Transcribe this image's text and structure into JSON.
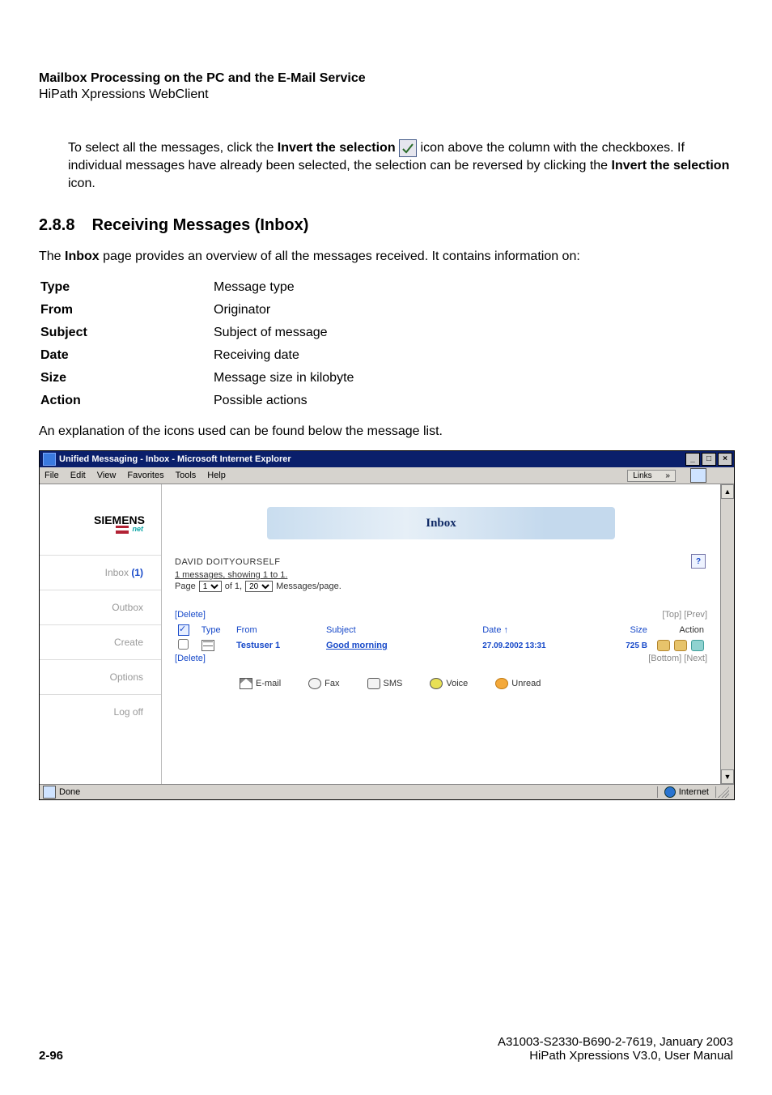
{
  "header": {
    "title": "Mailbox Processing on the PC and the E-Mail Service",
    "subtitle": "HiPath Xpressions WebClient"
  },
  "intro": {
    "pre": "To select all the messages, click the ",
    "bold1": "Invert the selection",
    "mid": " icon above the column with the checkboxes. If individual messages have already been selected, the selection can be reversed by clicking the ",
    "bold2": "Invert the selection",
    "post": " icon."
  },
  "section": {
    "number": "2.8.8",
    "title": "Receiving Messages (Inbox)"
  },
  "lead": {
    "pre": "The ",
    "bold": "Inbox",
    "post": " page provides an overview of all the messages received. It contains information on:"
  },
  "defs": [
    {
      "term": "Type",
      "desc": "Message type"
    },
    {
      "term": "From",
      "desc": "Originator"
    },
    {
      "term": "Subject",
      "desc": "Subject of message"
    },
    {
      "term": "Date",
      "desc": "Receiving date"
    },
    {
      "term": "Size",
      "desc": "Message size in kilobyte"
    },
    {
      "term": "Action",
      "desc": "Possible actions"
    }
  ],
  "explain": "An explanation of the icons used can be found below the message list.",
  "shot": {
    "title": "Unified Messaging - Inbox - Microsoft Internet Explorer",
    "menus": {
      "file": "File",
      "edit": "Edit",
      "view": "View",
      "favorites": "Favorites",
      "tools": "Tools",
      "help": "Help"
    },
    "links_label": "Links",
    "logo": {
      "brand": "SIEMENS",
      "suffix": "net"
    },
    "nav": {
      "inbox_label": "Inbox",
      "inbox_count": "(1)",
      "outbox": "Outbox",
      "create": "Create",
      "options": "Options",
      "logoff": "Log off"
    },
    "banner": "Inbox",
    "user": "DAVID DOITYOURSELF",
    "summary_line": "1 messages, showing 1 to 1.",
    "page_row": {
      "page": "Page",
      "val1": "1",
      "of": "of 1,",
      "val2": "20",
      "per": "Messages/page."
    },
    "actions": {
      "delete": "Delete",
      "top": "Top",
      "prev": "Prev",
      "bottom": "Bottom",
      "next": "Next"
    },
    "cols": {
      "type": "Type",
      "from": "From",
      "subject": "Subject",
      "date": "Date",
      "size": "Size",
      "action": "Action"
    },
    "row": {
      "from": "Testuser 1",
      "subject": "Good morning",
      "date": "27.09.2002 13:31",
      "size": "725 B"
    },
    "legend": {
      "email": "E-mail",
      "fax": "Fax",
      "sms": "SMS",
      "voice": "Voice",
      "unread": "Unread"
    },
    "status": {
      "done": "Done",
      "zone": "Internet"
    }
  },
  "footer": {
    "page": "2-96",
    "ref": "A31003-S2330-B690-2-7619, January 2003",
    "product": "HiPath Xpressions V3.0, User Manual"
  }
}
